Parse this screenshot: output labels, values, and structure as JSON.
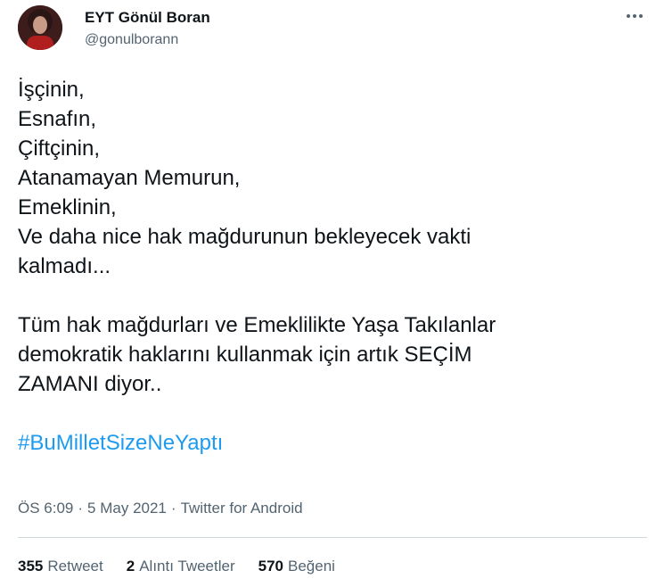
{
  "author": {
    "display_name": "EYT Gönül Boran",
    "handle": "@gonulborann"
  },
  "tweet": {
    "lines": [
      "İşçinin,",
      "Esnafın,",
      "Çiftçinin,",
      "Atanamayan Memurun,",
      "Emeklinin,",
      "Ve daha nice hak mağdurunun bekleyecek vakti",
      "kalmadı...",
      "",
      "Tüm hak mağdurları ve Emeklilikte Yaşa Takılanlar",
      "demokratik haklarını kullanmak için artık SEÇİM",
      "ZAMANI diyor.."
    ],
    "hashtag": "#BuMilletSizeNeYaptı"
  },
  "meta": {
    "time": "ÖS 6:09",
    "separator": "·",
    "date": "5 May 2021",
    "source": "Twitter for Android"
  },
  "stats": {
    "retweets_count": "355",
    "retweets_label": "Retweet",
    "quotes_count": "2",
    "quotes_label": "Alıntı Tweetler",
    "likes_count": "570",
    "likes_label": "Beğeni"
  },
  "icons": {
    "more": "more-horizontal-icon"
  },
  "colors": {
    "link": "#1d9bf0",
    "secondary_text": "#536471",
    "divider": "#cfd9de"
  }
}
